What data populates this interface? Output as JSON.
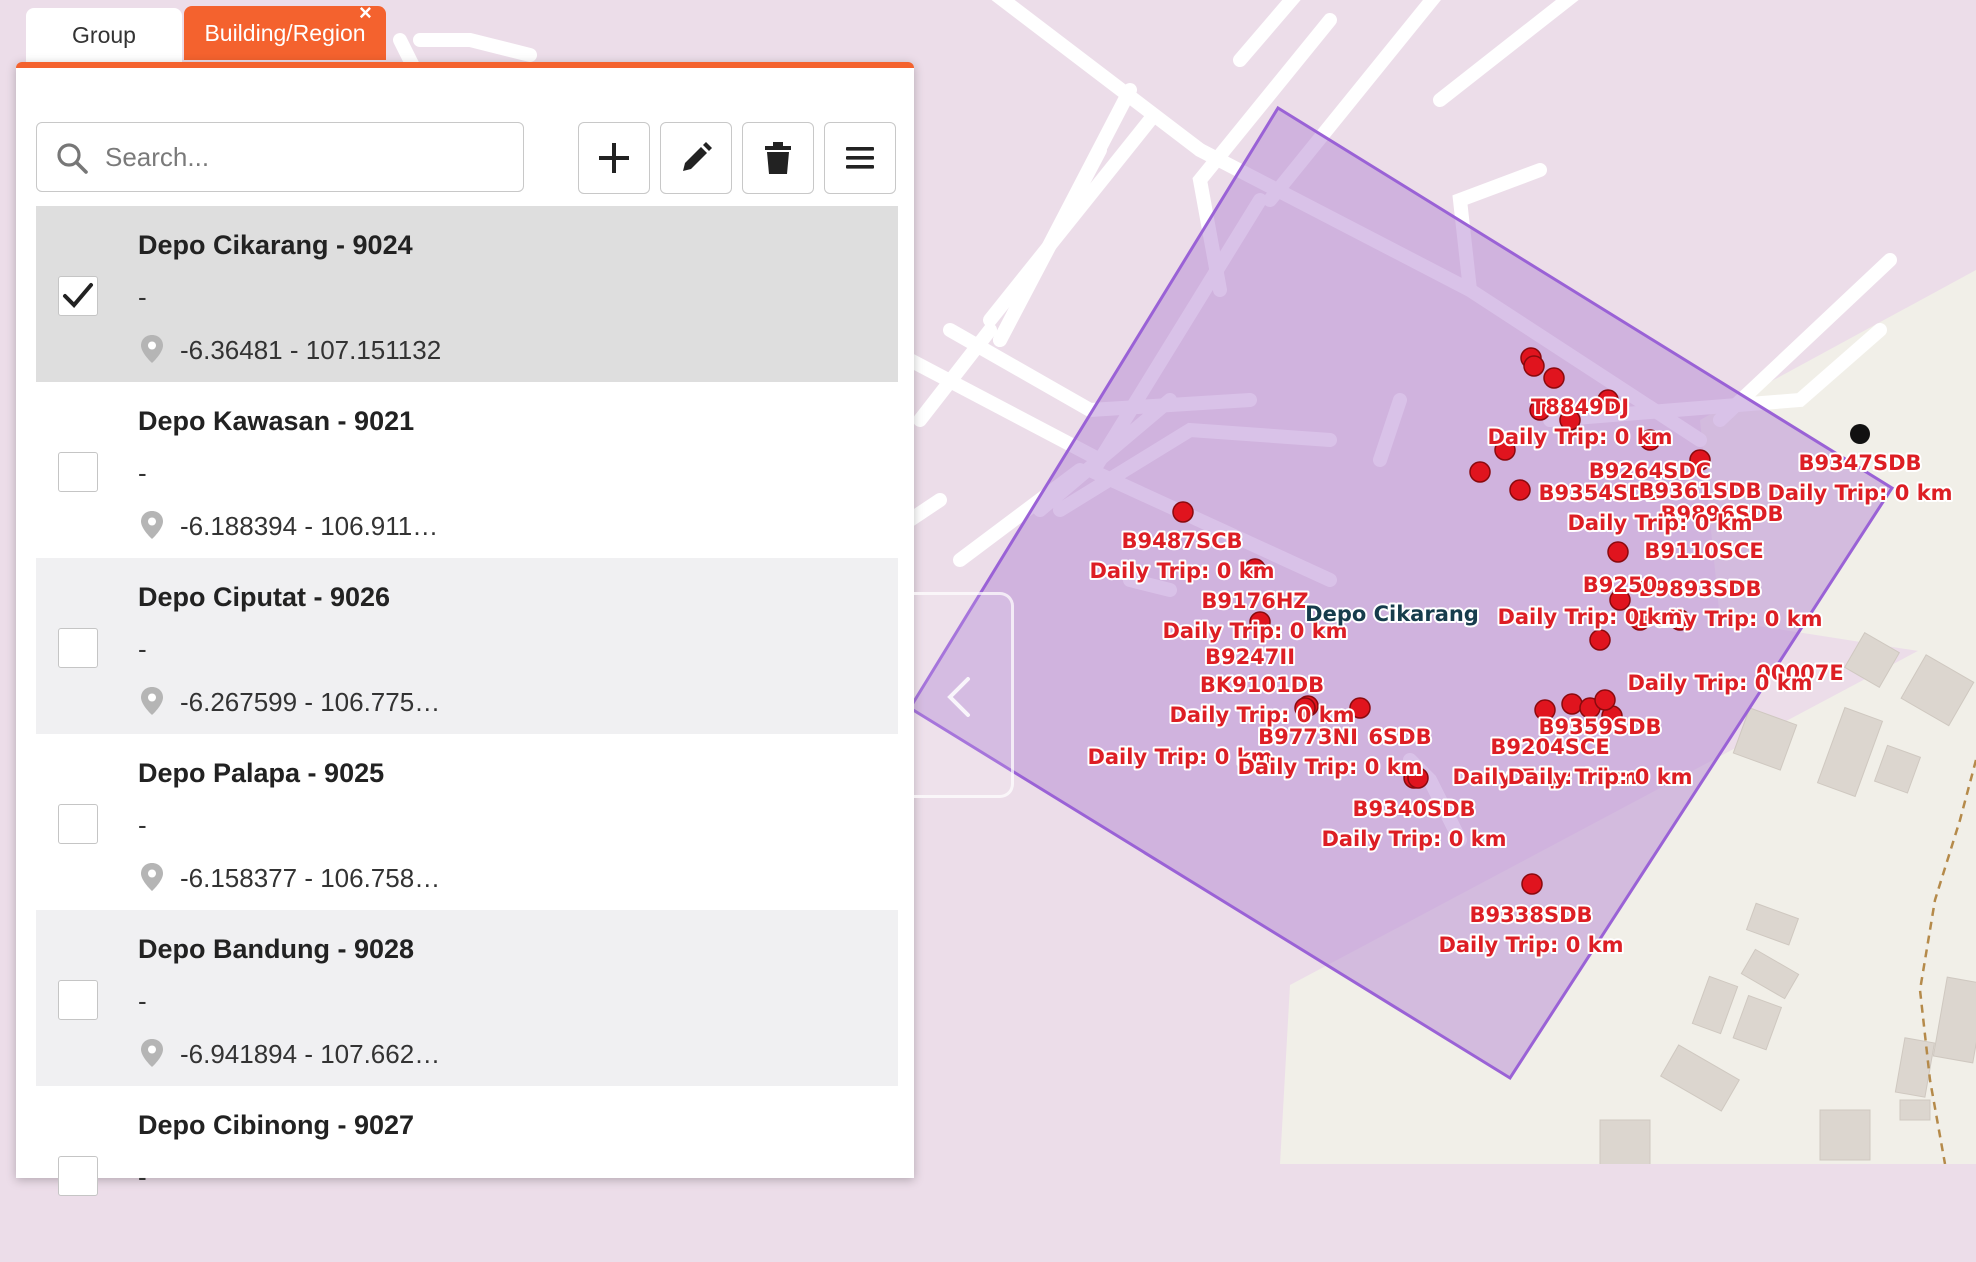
{
  "tabs": [
    {
      "label": "Group"
    },
    {
      "label": "Building/Region"
    }
  ],
  "tab_close_glyph": "×",
  "search": {
    "placeholder": "Search..."
  },
  "toolbar": [
    "plus-icon",
    "pencil-icon",
    "trash-icon",
    "menu-icon"
  ],
  "list": [
    {
      "name": "Depo Cikarang - 9024",
      "desc": "-",
      "coord": "-6.36481 - 107.151132",
      "checked": true
    },
    {
      "name": "Depo Kawasan - 9021",
      "desc": "-",
      "coord": "-6.188394 - 106.911…",
      "checked": false
    },
    {
      "name": "Depo Ciputat - 9026",
      "desc": "-",
      "coord": "-6.267599 - 106.775…",
      "checked": false
    },
    {
      "name": "Depo Palapa - 9025",
      "desc": "-",
      "coord": "-6.158377 - 106.758…",
      "checked": false
    },
    {
      "name": "Depo Bandung - 9028",
      "desc": "-",
      "coord": "-6.941894 - 107.662…",
      "checked": false
    },
    {
      "name": "Depo Cibinong - 9027",
      "desc": "-",
      "coord": "",
      "checked": false
    }
  ],
  "map": {
    "region_label": "Depo Cikarang",
    "colors": {
      "region_fill": "#b98fd6",
      "region_stroke": "#9a62d6",
      "vehicle_label": "#dd1e24",
      "marker": "#e0141e"
    },
    "labels": [
      "B9487SCB",
      "Daily Trip: 0 km",
      "B9176HZ",
      "Daily Trip: 0 km",
      "B9247II",
      "BK9101DB",
      "Daily Trip: 0 km",
      "B9773NI",
      "6SDB",
      "Daily Trip: 0 km",
      "Daily Trip: 0 km",
      "B9340SDB",
      "Daily Trip: 0 km",
      "B9338SDB",
      "Daily Trip: 0 km",
      "B9347SDB",
      "Daily Trip: 0 km",
      "T8849DJ",
      "Daily Trip: 0 km",
      "B9264SDC",
      "B9354SDB",
      "B9361SDB",
      "B9896SDB",
      "Daily Trip: 0 km",
      "B9110SCE",
      "B9893SDB",
      "Daily Trip: 0 km",
      "B9250",
      "Daily Trip: 0 km",
      "00007E",
      "Daily Trip: 0 km",
      "B9359SDB",
      "B9204SCE",
      "Daily Trip: 0 km",
      "Daily Trip: 0 km"
    ]
  }
}
